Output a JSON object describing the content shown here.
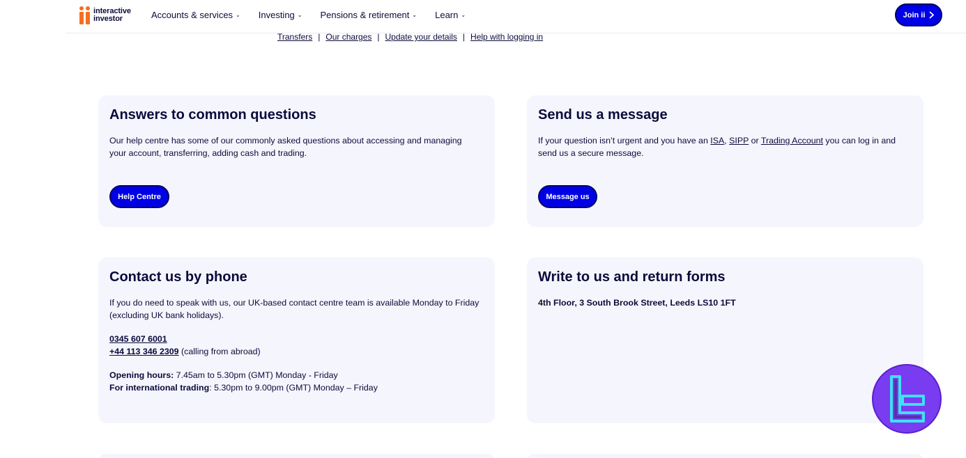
{
  "header": {
    "logo_line1": "interactive",
    "logo_line2": "investor",
    "nav": [
      {
        "label": "Accounts & services"
      },
      {
        "label": "Investing"
      },
      {
        "label": "Pensions & retirement"
      },
      {
        "label": "Learn"
      }
    ],
    "join_label": "Join ii"
  },
  "sublinks": [
    "Transfers",
    "Our charges",
    "Update your details",
    "Help with logging in"
  ],
  "cards": {
    "questions": {
      "title": "Answers to common questions",
      "body": "Our help centre has some of our commonly asked questions about accessing and managing your account, transferring, adding cash and trading.",
      "button": "Help Centre"
    },
    "message": {
      "title": "Send us a message",
      "body_pre": "If your question isn’t urgent and you have an ",
      "link_isa": "ISA",
      "comma": ", ",
      "link_sipp": "SIPP",
      "or": " or ",
      "link_trading": "Trading Account",
      "body_post": " you can log in and send us a secure message.",
      "button": "Message us"
    },
    "phone": {
      "title": "Contact us by phone",
      "body": "If you do need to speak with us, our UK-based contact centre team is available Monday to Friday (excluding UK bank holidays).",
      "phone_uk": "0345 607 6001",
      "phone_abroad": "+44 113 346 2309",
      "abroad_note": " (calling from abroad)",
      "hours_label": "Opening hours:",
      "hours_value": " 7.45am to 5.30pm (GMT) Monday - Friday",
      "intl_label": "For international trading",
      "intl_value": ": 5.30pm to 9.00pm (GMT) Monday – Friday"
    },
    "write": {
      "title": "Write to us and return forms",
      "address": "4th Floor, 3 South Brook Street, Leeds LS10 1FT"
    }
  },
  "colors": {
    "accent": "#0000e6",
    "brand_orange": "#f36f21",
    "card_bg": "#f5f5fd",
    "text": "#0b0b3b",
    "watermark": "#7a3cf0",
    "watermark_glyph": "#3fe0f5"
  }
}
